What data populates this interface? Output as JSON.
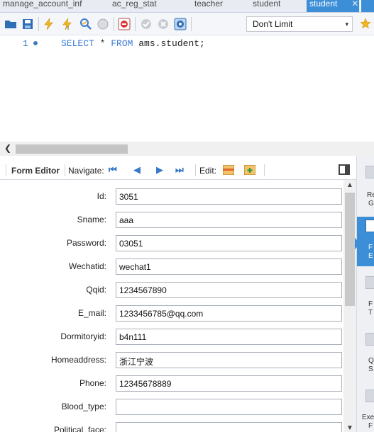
{
  "tabs": [
    {
      "label": "manage_account_inf"
    },
    {
      "label": "ac_reg_stat"
    },
    {
      "label": "teacher"
    },
    {
      "label": "student"
    },
    {
      "label": "student",
      "close": "✕"
    }
  ],
  "toolbar": {
    "limit_select": "Don't Limit",
    "limit_arrow": "▾"
  },
  "editor": {
    "line_number": "1",
    "sql": {
      "select": "SELECT",
      "star": " * ",
      "from": "FROM",
      "rest": " ams.student;"
    }
  },
  "form_header": {
    "form_editor": "Form Editor",
    "navigate": "Navigate:",
    "edit": "Edit:",
    "nav_first": "⏮",
    "nav_prev": "◀",
    "nav_next": "▶",
    "nav_last": "⏭"
  },
  "form": {
    "fields": [
      {
        "label": "Id:",
        "value": "3051"
      },
      {
        "label": "Sname:",
        "value": "aaa"
      },
      {
        "label": "Password:",
        "value": "03051"
      },
      {
        "label": "Wechatid:",
        "value": "wechat1"
      },
      {
        "label": "Qqid:",
        "value": "1234567890"
      },
      {
        "label": "E_mail:",
        "value": "1233456785@qq.com"
      },
      {
        "label": "Dormitoryid:",
        "value": "b4n111"
      },
      {
        "label": "Homeaddress:",
        "value": "浙江宁波"
      },
      {
        "label": "Phone:",
        "value": "12345678889"
      },
      {
        "label": "Blood_type:",
        "value": ""
      },
      {
        "label": "Political_face:",
        "value": ""
      }
    ]
  },
  "side_panel": {
    "items": [
      {
        "t1": "Re",
        "t2": "G"
      },
      {
        "t1": "F",
        "t2": "E"
      },
      {
        "t1": "F",
        "t2": "T"
      },
      {
        "t1": "Q",
        "t2": "S"
      },
      {
        "t1": "Exe",
        "t2": "F"
      }
    ]
  },
  "colors": {
    "accent": "#3c8ed6",
    "keyword": "#3a7bd5"
  }
}
